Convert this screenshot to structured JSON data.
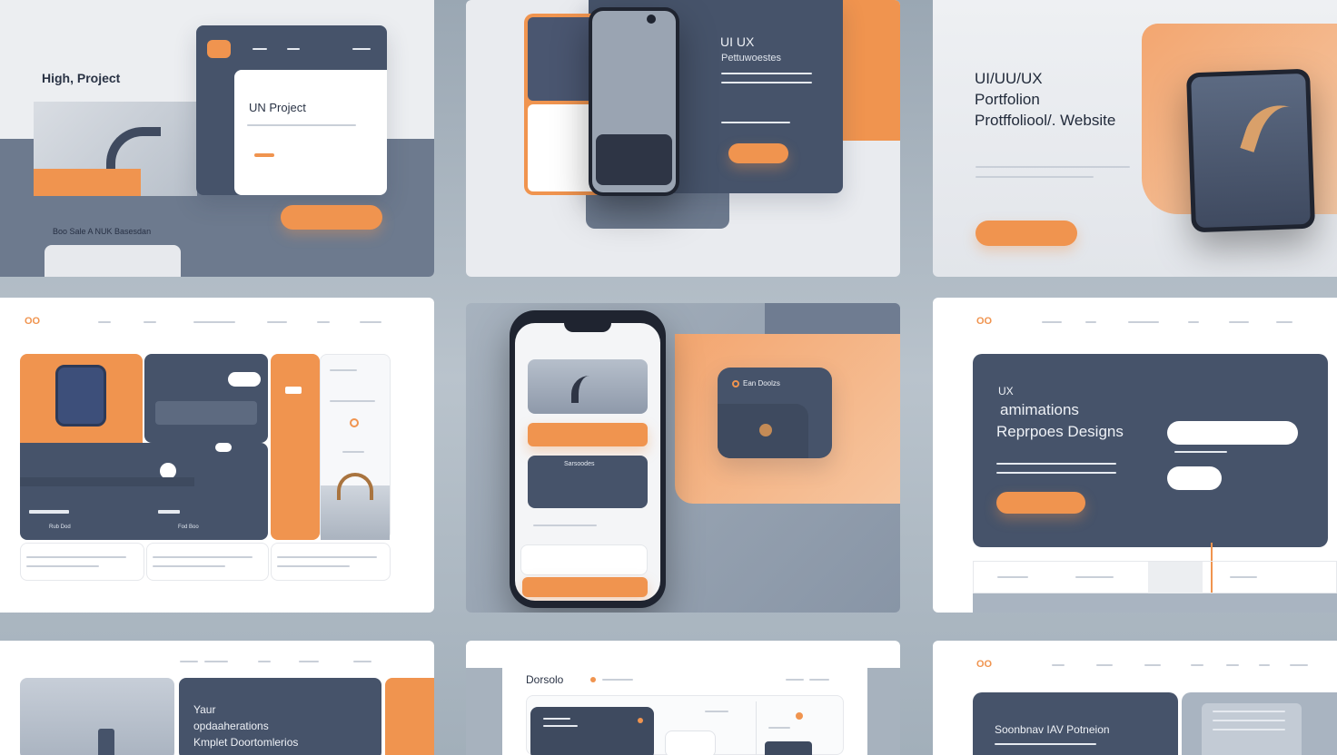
{
  "palette": {
    "navy": "#46536a",
    "orange": "#f0944f",
    "light": "#eceef1"
  },
  "tile1": {
    "title": "High, Project",
    "card_title": "UN Project",
    "bottom_text": "Boo Sale A NUK Basesdan"
  },
  "tile2": {
    "heading": "UI UX",
    "subheading": "Pettuwoestes"
  },
  "tile3": {
    "line1": "UI/UU/UX",
    "line2": "Portfolion",
    "line3": "Protffoliool/. Website"
  },
  "tile4": {
    "logo": "OO",
    "caption1": "Rub Dod",
    "caption2": "Fod Boo"
  },
  "tile5": {
    "card_label": "Ean Doolzs",
    "list_label": "Sarsoodes"
  },
  "tile6": {
    "logo": "OO",
    "line1": "UX",
    "line2": "amimations",
    "line3": "Reprpoes Designs"
  },
  "tile7": {
    "line1": "Yaur",
    "line2": "opdaaherations",
    "line3": "Kmplet Doortomlerios"
  },
  "tile8": {
    "title": "Dorsolo"
  },
  "tile9": {
    "logo": "OO",
    "card_title": "Soonbnav IAV Potneion"
  }
}
